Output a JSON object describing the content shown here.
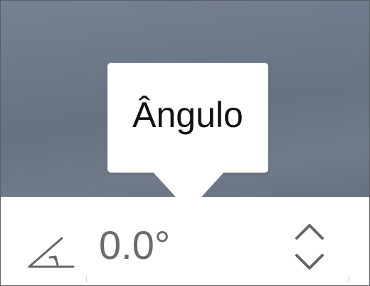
{
  "tooltip": {
    "label": "Ângulo"
  },
  "angle_control": {
    "value": "0.0°",
    "icon": "angle-icon",
    "increment_icon": "chevron-up-icon",
    "decrement_icon": "chevron-down-icon"
  },
  "colors": {
    "backdrop": "#6e7989",
    "tooltip_bg": "#ffffff",
    "value_text": "#6b6b6b",
    "icon_stroke": "#666666"
  }
}
